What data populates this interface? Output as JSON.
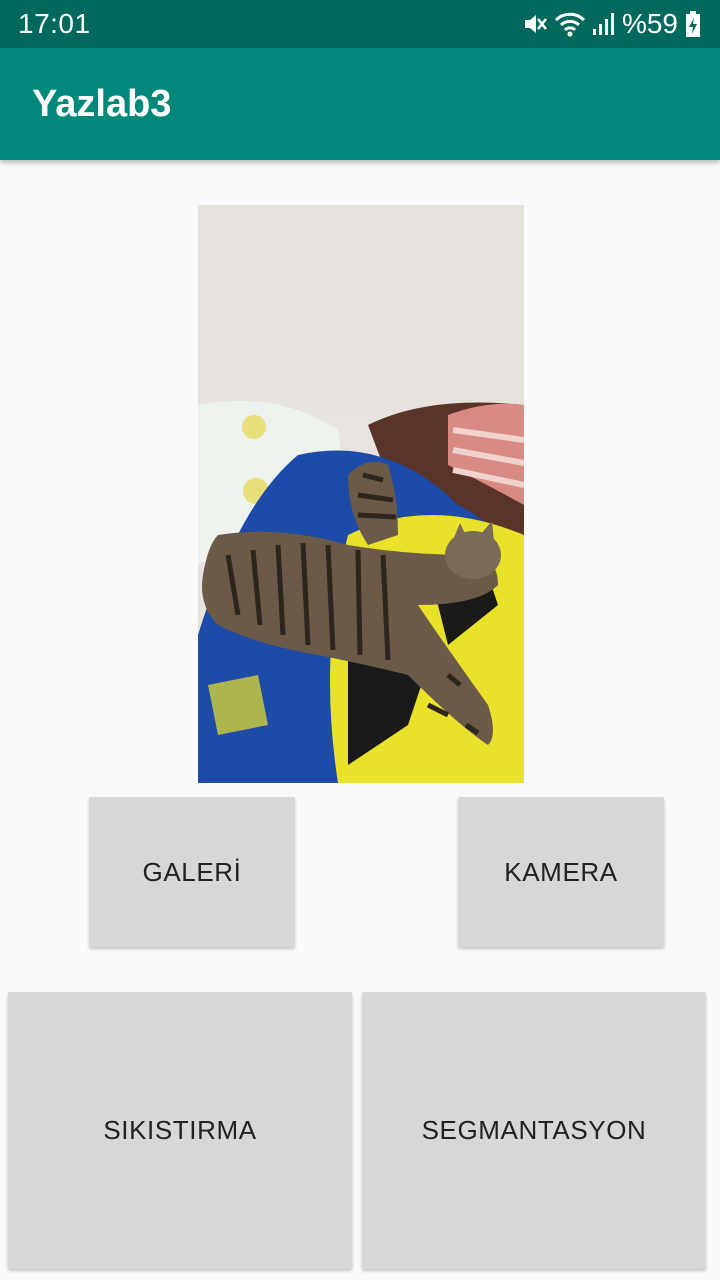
{
  "status_bar": {
    "time": "17:01",
    "battery": "%59",
    "icons": [
      "mute-icon",
      "wifi-icon",
      "signal-icon",
      "battery-charging-icon"
    ]
  },
  "app_bar": {
    "title": "Yazlab3",
    "color": "#00897b"
  },
  "image": {
    "description_icon": "photo-icon"
  },
  "buttons": {
    "galeri": "GALERİ",
    "kamera": "KAMERA",
    "sikistirma": "SIKISTIRMA",
    "segmentasyon": "SEGMANTASYON"
  }
}
